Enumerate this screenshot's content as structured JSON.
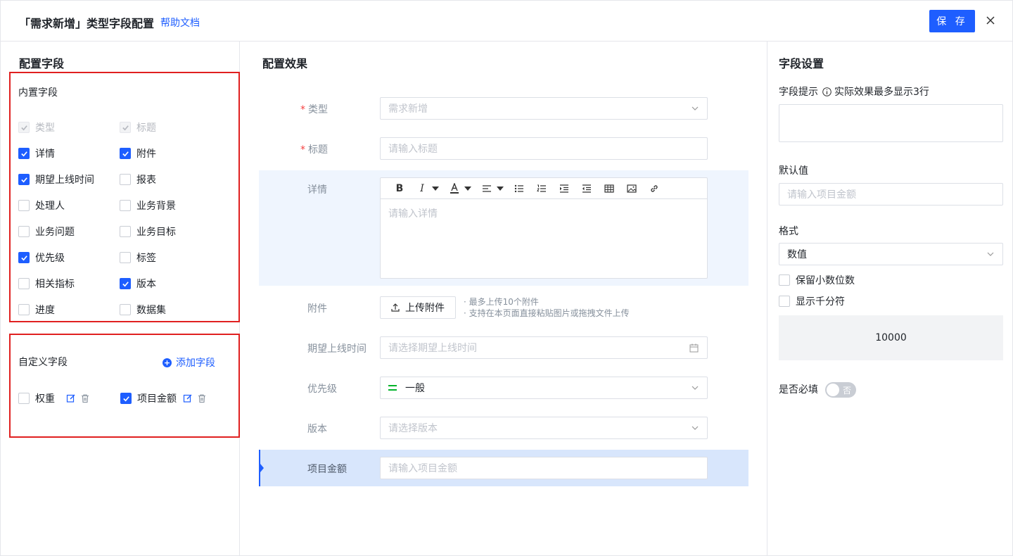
{
  "header": {
    "title": "「需求新增」类型字段配置",
    "help_link": "帮助文档",
    "save_label": "保 存",
    "close_label": "X"
  },
  "left": {
    "title": "配置字段",
    "builtin": {
      "label": "内置字段",
      "fields": [
        {
          "label": "类型",
          "checked": true,
          "disabled": true
        },
        {
          "label": "标题",
          "checked": true,
          "disabled": true
        },
        {
          "label": "详情",
          "checked": true,
          "disabled": false
        },
        {
          "label": "附件",
          "checked": true,
          "disabled": false
        },
        {
          "label": "期望上线时间",
          "checked": true,
          "disabled": false
        },
        {
          "label": "报表",
          "checked": false,
          "disabled": false
        },
        {
          "label": "处理人",
          "checked": false,
          "disabled": false
        },
        {
          "label": "业务背景",
          "checked": false,
          "disabled": false
        },
        {
          "label": "业务问题",
          "checked": false,
          "disabled": false
        },
        {
          "label": "业务目标",
          "checked": false,
          "disabled": false
        },
        {
          "label": "优先级",
          "checked": true,
          "disabled": false
        },
        {
          "label": "标签",
          "checked": false,
          "disabled": false
        },
        {
          "label": "相关指标",
          "checked": false,
          "disabled": false
        },
        {
          "label": "版本",
          "checked": true,
          "disabled": false
        },
        {
          "label": "进度",
          "checked": false,
          "disabled": false
        },
        {
          "label": "数据集",
          "checked": false,
          "disabled": false
        }
      ]
    },
    "custom": {
      "label": "自定义字段",
      "add_label": "添加字段",
      "fields": [
        {
          "label": "权重",
          "checked": false
        },
        {
          "label": "项目金额",
          "checked": true
        }
      ]
    }
  },
  "middle": {
    "title": "配置效果",
    "type": {
      "label": "类型",
      "value": "需求新增"
    },
    "title_field": {
      "label": "标题",
      "placeholder": "请输入标题"
    },
    "detail": {
      "label": "详情",
      "placeholder": "请输入详情"
    },
    "attachment": {
      "label": "附件",
      "button": "上传附件",
      "hints": [
        "· 最多上传10个附件",
        "· 支持在本页面直接粘贴图片或拖拽文件上传"
      ]
    },
    "expected_time": {
      "label": "期望上线时间",
      "placeholder": "请选择期望上线时间"
    },
    "priority": {
      "label": "优先级",
      "value": "一般"
    },
    "version": {
      "label": "版本",
      "placeholder": "请选择版本"
    },
    "amount": {
      "label": "项目金额",
      "placeholder": "请输入项目金额"
    }
  },
  "right": {
    "title": "字段设置",
    "hint_label": "字段提示",
    "hint_note": "实际效果最多显示3行",
    "default_label": "默认值",
    "default_placeholder": "请输入项目金额",
    "format_label": "格式",
    "format_value": "数值",
    "keep_decimal": "保留小数位数",
    "thousand_sep": "显示千分符",
    "preview_value": "10000",
    "required_label": "是否必填",
    "required_toggle": "否"
  },
  "colors": {
    "accent": "#1e5eff",
    "highlight_box": "#e02020",
    "selected_row_bg": "#d8e6fc",
    "detail_row_bg": "#eff5fe",
    "priority_green": "#00b42a"
  }
}
